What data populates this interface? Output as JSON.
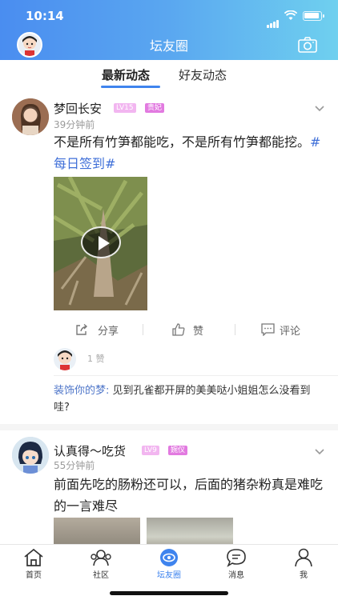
{
  "status_bar": {
    "time": "10:14"
  },
  "header": {
    "title": "坛友圈",
    "left_icon": "avatar",
    "right_icon": "camera-icon"
  },
  "tabs": [
    {
      "label": "最新动态",
      "active": true
    },
    {
      "label": "好友动态",
      "active": false
    }
  ],
  "posts": [
    {
      "user": "梦回长安",
      "level": "LV15",
      "role": "贵妃",
      "time": "39分钟前",
      "text": "不是所有竹笋都能吃，不是所有竹笋都能挖。",
      "tag": "#每日签到#",
      "media": "video",
      "actions": {
        "share": "分享",
        "like": "赞",
        "comment": "评论"
      },
      "likes": "1 赞",
      "comment": {
        "user": "装饰你的梦:",
        "text": " 见到孔雀都开屏的美美哒小姐姐怎么没看到哇?"
      }
    },
    {
      "user": "认真得～吃货",
      "level": "LV9",
      "role": "婉仪",
      "time": "55分钟前",
      "text": "前面先吃的肠粉还可以，后面的猪杂粉真是难吃的一言难尽"
    }
  ],
  "tab_bar": [
    {
      "label": "首页",
      "icon": "home-icon",
      "active": false
    },
    {
      "label": "社区",
      "icon": "community-icon",
      "active": false
    },
    {
      "label": "坛友圈",
      "icon": "circle-eye-icon",
      "active": true
    },
    {
      "label": "消息",
      "icon": "message-icon",
      "active": false
    },
    {
      "label": "我",
      "icon": "person-icon",
      "active": false
    }
  ],
  "colors": {
    "accent": "#3f84ee",
    "header_start": "#4a8df0",
    "header_end": "#6fd0ef",
    "tag": "#3f6fd8",
    "badge_level": "#f2b6f0",
    "badge_role": "#e27ae0"
  }
}
